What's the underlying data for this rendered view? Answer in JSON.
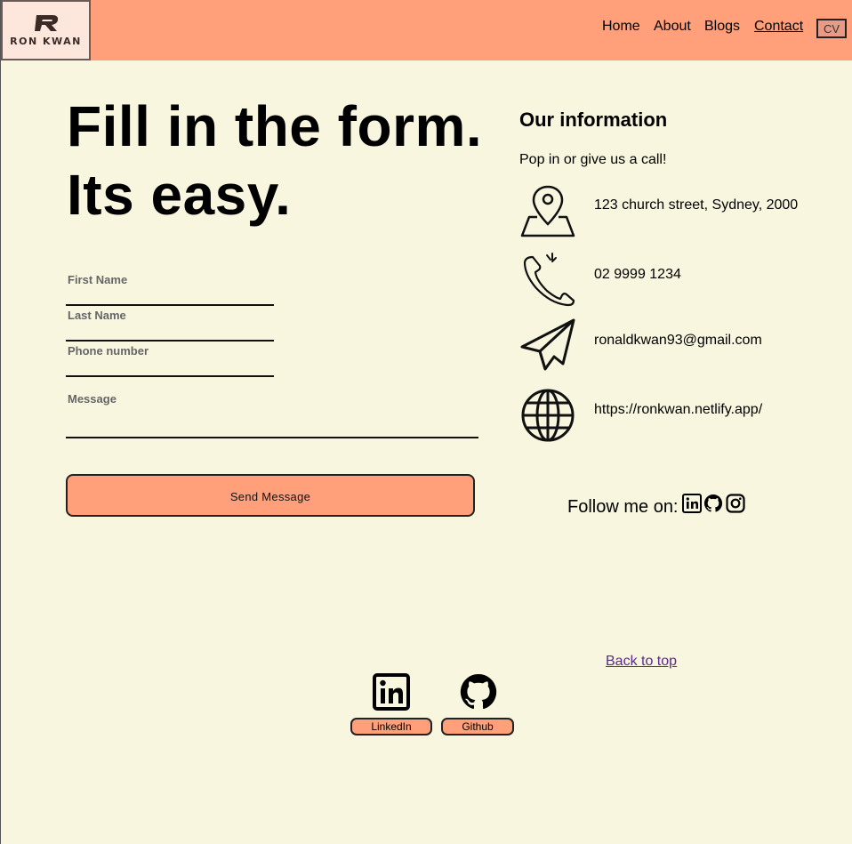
{
  "header": {
    "logo_text": "RON KWAN",
    "nav": [
      "Home",
      "About",
      "Blogs",
      "Contact"
    ],
    "cv_label": "CV"
  },
  "main": {
    "heading_line1": "Fill in the form.",
    "heading_line2": "Its easy."
  },
  "form": {
    "first_name_label": "First Name",
    "last_name_label": "Last Name",
    "phone_label": "Phone number",
    "message_label": "Message",
    "send_label": "Send Message"
  },
  "info": {
    "title": "Our information",
    "subtitle": "Pop in or give us a call!",
    "address": "123 church street, Sydney, 2000",
    "phone": "02 9999 1234",
    "email": "ronaldkwan93@gmail.com",
    "website": "https://ronkwan.netlify.app/",
    "follow_label": "Follow me on:"
  },
  "footer": {
    "back_to_top": "Back to top",
    "linkedin_label": "LinkedIn",
    "github_label": "Github"
  },
  "colors": {
    "background": "#f8f6df",
    "accent": "#ffa07a"
  }
}
